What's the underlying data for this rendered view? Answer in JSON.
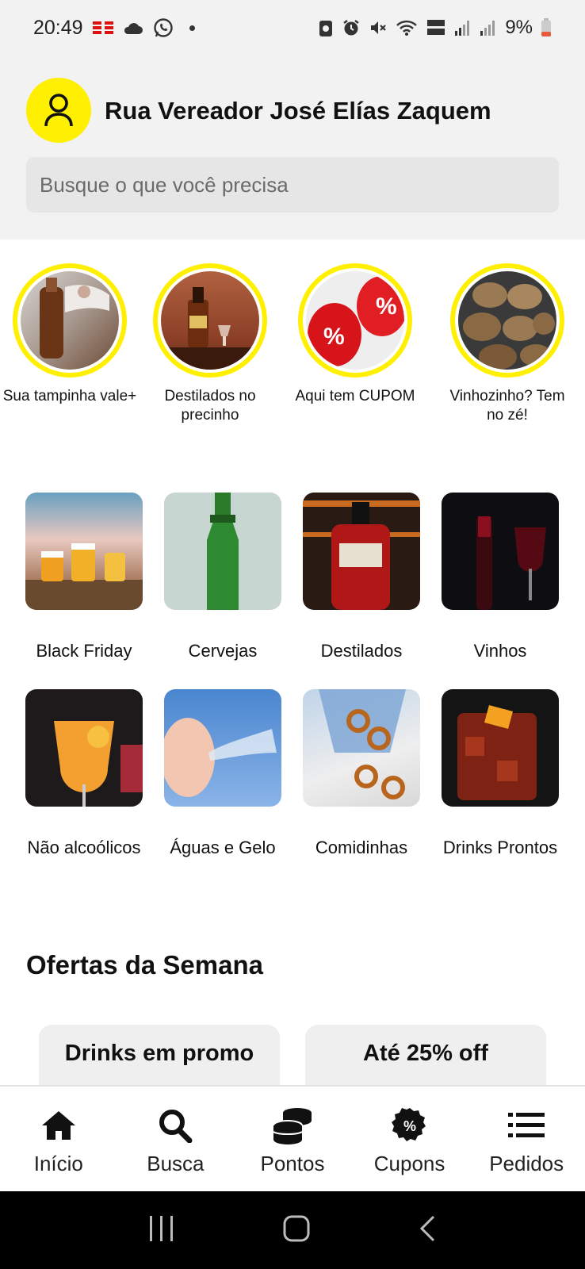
{
  "status_bar": {
    "time": "20:49",
    "battery": "9%"
  },
  "header": {
    "address": "Rua Vereador José Elías Zaquem",
    "search_placeholder": "Busque o que você precisa"
  },
  "stories": [
    {
      "label": "Sua tampinha vale+"
    },
    {
      "label": "Destilados no precinho"
    },
    {
      "label": "Aqui tem CUPOM"
    },
    {
      "label": "Vinhozinho? Tem no zé!"
    }
  ],
  "categories": [
    {
      "label": "Black Friday"
    },
    {
      "label": "Cervejas"
    },
    {
      "label": "Destilados"
    },
    {
      "label": "Vinhos"
    },
    {
      "label": "Não alcoólicos"
    },
    {
      "label": "Águas e Gelo"
    },
    {
      "label": "Comidinhas"
    },
    {
      "label": "Drinks Prontos"
    }
  ],
  "offers": {
    "title": "Ofertas da Semana",
    "items": [
      {
        "label": "Drinks em promo"
      },
      {
        "label": "Até 25% off"
      }
    ]
  },
  "bottom_nav": [
    {
      "label": "Início",
      "icon": "home-icon"
    },
    {
      "label": "Busca",
      "icon": "search-icon"
    },
    {
      "label": "Pontos",
      "icon": "coins-icon"
    },
    {
      "label": "Cupons",
      "icon": "coupon-icon"
    },
    {
      "label": "Pedidos",
      "icon": "list-icon"
    }
  ],
  "colors": {
    "accent": "#ffef00",
    "header_bg": "#f2f2f2",
    "search_bg": "#e6e6e6"
  }
}
